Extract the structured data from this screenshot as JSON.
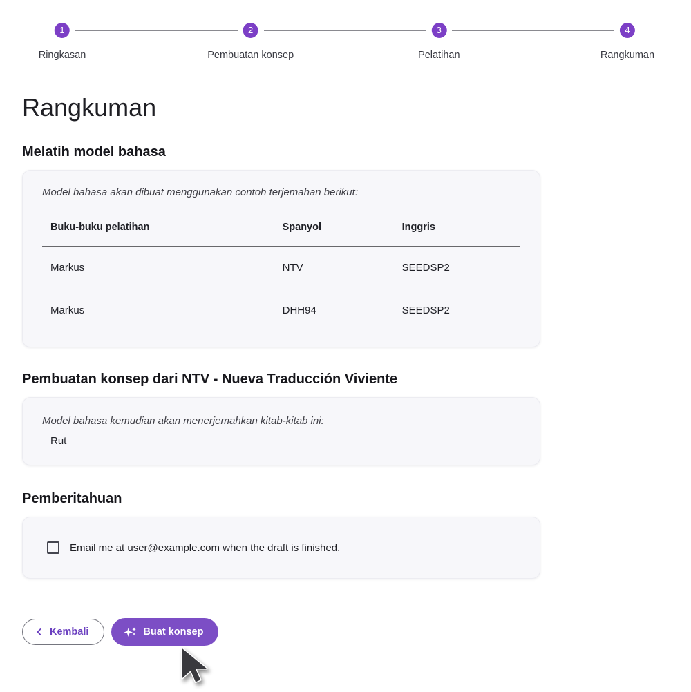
{
  "theme": {
    "primary": "#7c3fc6",
    "primary_button": "#7c4ec5",
    "primary_dark": "#6b40c0",
    "text": "#1c1c21",
    "label": "#3a3b43",
    "line": "#8a8a90",
    "card_bg": "#f7f7fa",
    "card_border": "#ececf1",
    "outline": "#75767f"
  },
  "stepper": {
    "steps": [
      {
        "number": "1",
        "label": "Ringkasan"
      },
      {
        "number": "2",
        "label": "Pembuatan konsep"
      },
      {
        "number": "3",
        "label": "Pelatihan"
      },
      {
        "number": "4",
        "label": "Rangkuman"
      }
    ]
  },
  "page": {
    "title": "Rangkuman"
  },
  "training_section": {
    "heading": "Melatih model bahasa",
    "intro": "Model bahasa akan dibuat menggunakan contoh terjemahan berikut:",
    "table": {
      "columns": [
        "Buku-buku pelatihan",
        "Spanyol",
        "Inggris"
      ],
      "rows": [
        [
          "Markus",
          "NTV",
          "SEEDSP2"
        ],
        [
          "Markus",
          "DHH94",
          "SEEDSP2"
        ]
      ]
    }
  },
  "drafting_section": {
    "heading_prefix": "Pembuatan konsep dari ",
    "project_name": "NTV - Nueva Traducción Viviente",
    "intro": "Model bahasa kemudian akan menerjemahkan kitab-kitab ini:",
    "books": [
      "Rut"
    ]
  },
  "notifications_section": {
    "heading": "Pemberitahuan",
    "checkbox_label": "Email me at user@example.com when the draft is finished.",
    "checked": false
  },
  "actions": {
    "back_label": "Kembali",
    "generate_label": "Buat konsep"
  }
}
